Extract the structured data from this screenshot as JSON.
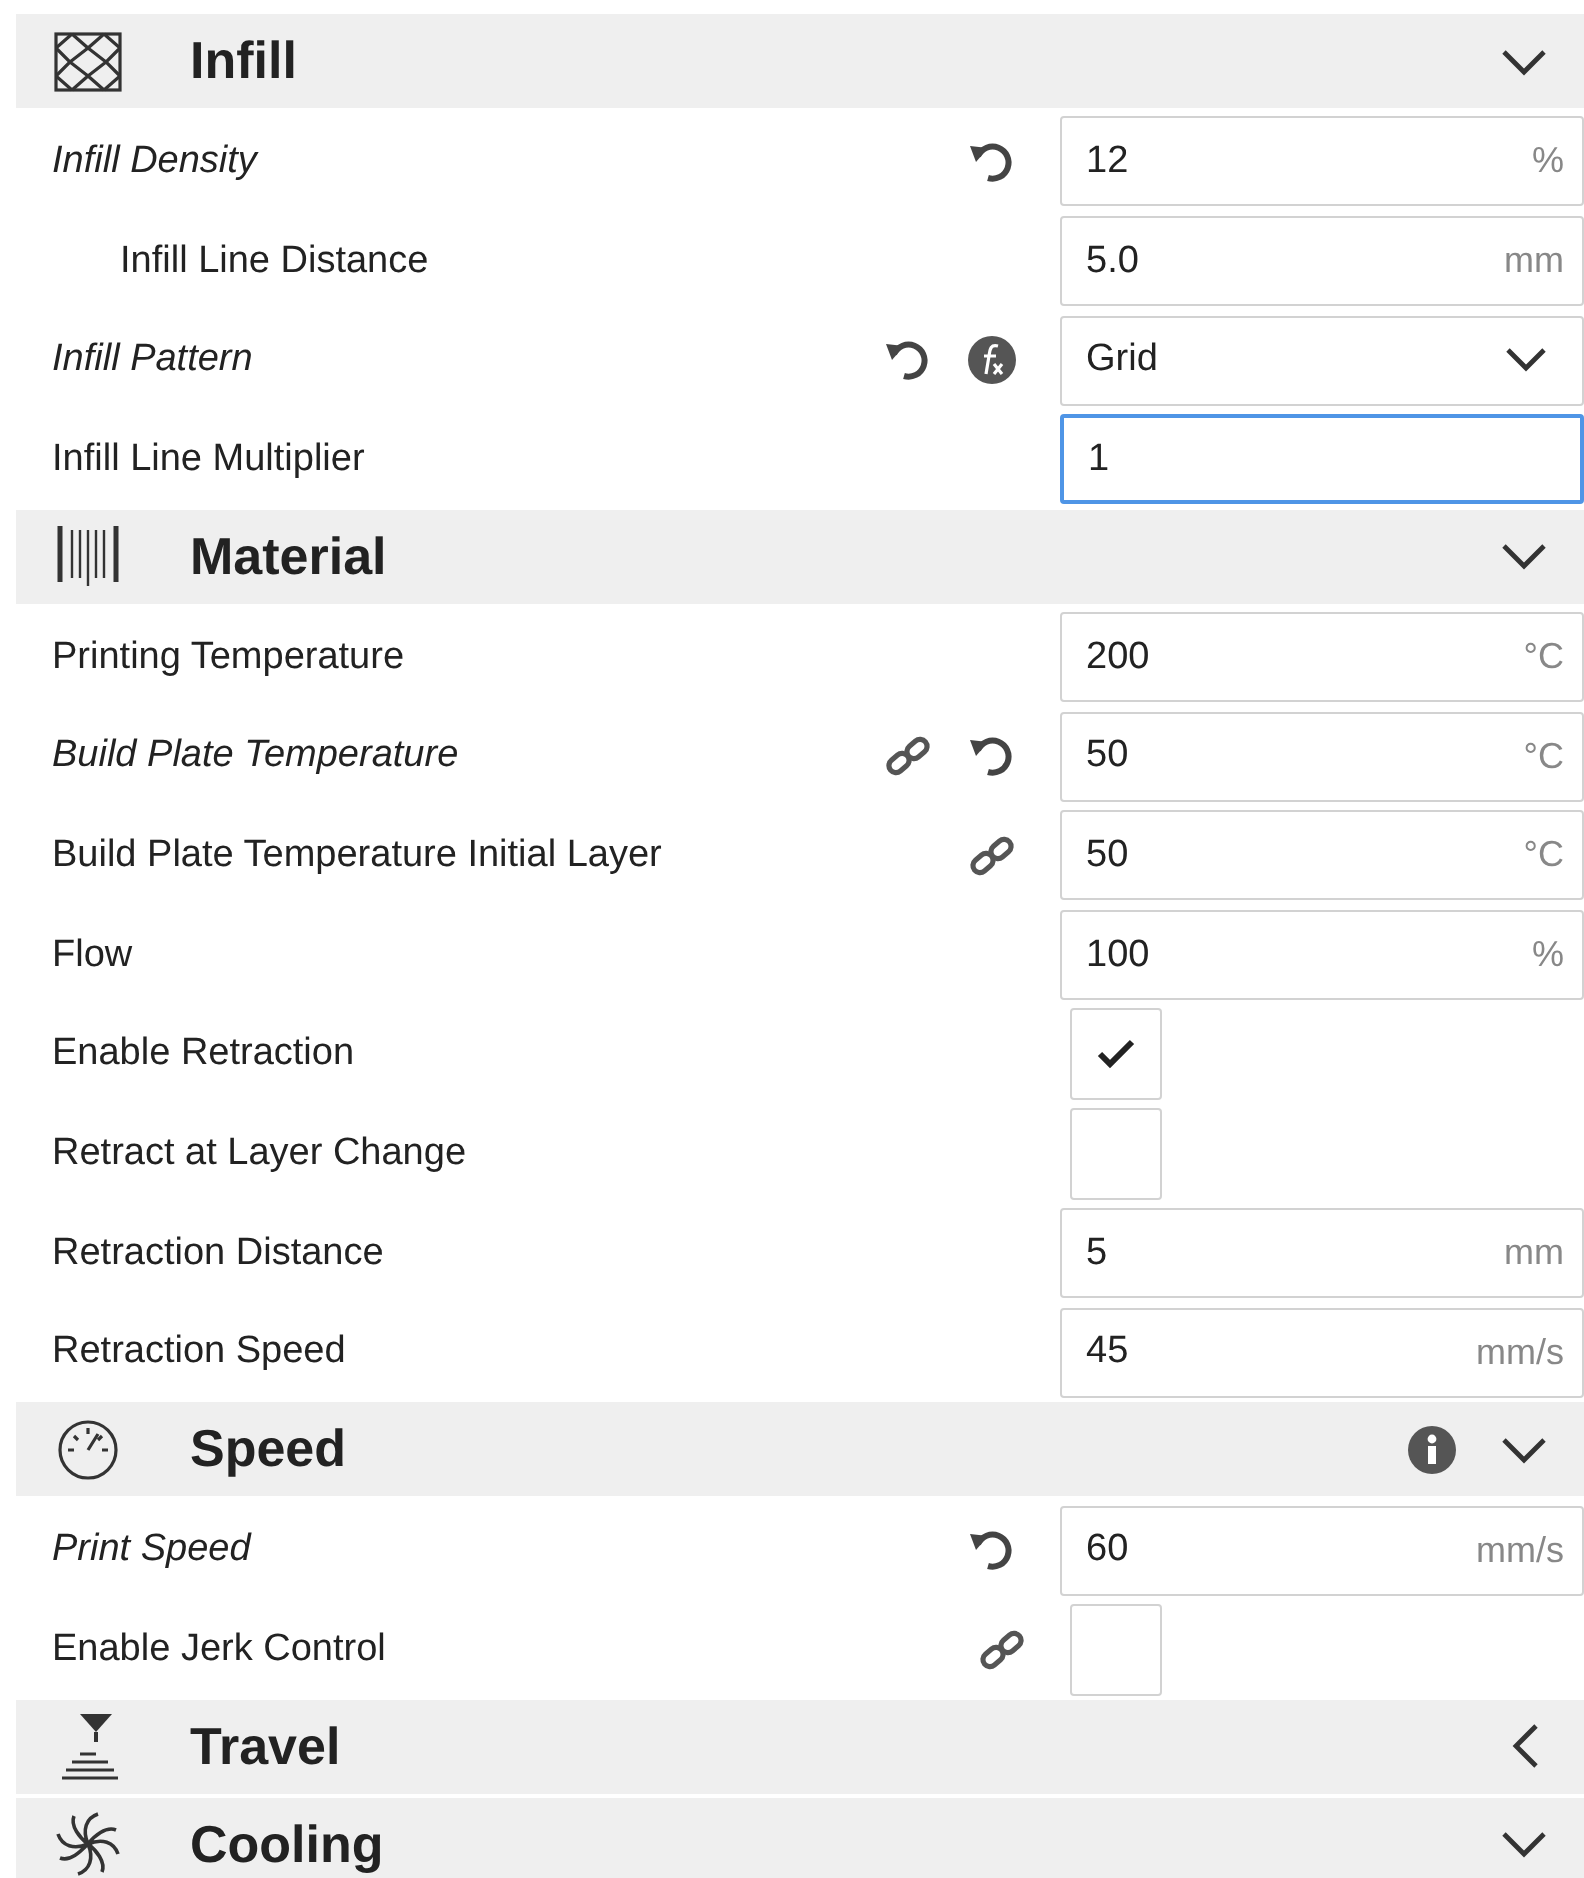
{
  "sections": [
    {
      "title": "Infill",
      "expanded": true,
      "info": false,
      "rows": [
        {
          "label": "Infill Density",
          "kind": "number",
          "value": "12",
          "unit": "%",
          "modified": true,
          "resettable": true,
          "children": [
            {
              "label": "Infill Line Distance",
              "kind": "number",
              "value": "5.0",
              "unit": "mm",
              "modified": false
            }
          ]
        },
        {
          "label": "Infill Pattern",
          "kind": "select",
          "value": "Grid",
          "modified": true,
          "resettable": true,
          "formula": true
        },
        {
          "label": "Infill Line Multiplier",
          "kind": "number",
          "value": "1",
          "modified": false,
          "focused": true
        }
      ]
    },
    {
      "title": "Material",
      "expanded": true,
      "info": false,
      "rows": [
        {
          "label": "Printing Temperature",
          "kind": "number",
          "value": "200",
          "unit": "°C",
          "modified": false
        },
        {
          "label": "Build Plate Temperature",
          "kind": "number",
          "value": "50",
          "unit": "°C",
          "modified": true,
          "linked": true,
          "resettable": true
        },
        {
          "label": "Build Plate Temperature Initial Layer",
          "kind": "number",
          "value": "50",
          "unit": "°C",
          "modified": false,
          "linked": true
        },
        {
          "label": "Flow",
          "kind": "number",
          "value": "100",
          "unit": "%",
          "modified": false
        },
        {
          "label": "Enable Retraction",
          "kind": "checkbox",
          "checked": true,
          "modified": false
        },
        {
          "label": "Retract at Layer Change",
          "kind": "checkbox",
          "checked": false,
          "modified": false
        },
        {
          "label": "Retraction Distance",
          "kind": "number",
          "value": "5",
          "unit": "mm",
          "modified": false
        },
        {
          "label": "Retraction Speed",
          "kind": "number",
          "value": "45",
          "unit": "mm/s",
          "modified": false
        }
      ]
    },
    {
      "title": "Speed",
      "expanded": true,
      "info": true,
      "rows": [
        {
          "label": "Print Speed",
          "kind": "number",
          "value": "60",
          "unit": "mm/s",
          "modified": true,
          "resettable": true
        },
        {
          "label": "Enable Jerk Control",
          "kind": "checkbox",
          "checked": false,
          "modified": false,
          "linked": true
        }
      ]
    },
    {
      "title": "Travel",
      "expanded": false,
      "info": false
    },
    {
      "title": "Cooling",
      "expanded": true,
      "info": false
    }
  ]
}
